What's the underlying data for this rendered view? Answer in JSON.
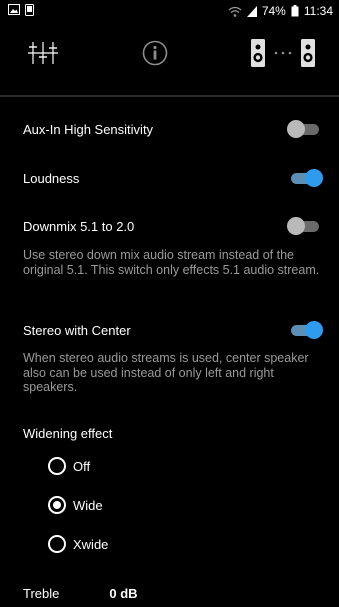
{
  "status_bar": {
    "battery": "74%",
    "time": "11:34",
    "left_icons": [
      "image-notification-icon",
      "phone-notification-icon"
    ],
    "right_icons": [
      "wifi-icon",
      "signal-icon",
      "battery-icon"
    ]
  },
  "top_tabs": [
    {
      "icon": "equalizer-sliders-icon",
      "selected": true
    },
    {
      "icon": "info-icon",
      "selected": false
    },
    {
      "icon": "speakers-icon",
      "selected": false
    }
  ],
  "settings": {
    "aux_in": {
      "label": "Aux-In High Sensitivity",
      "enabled": false
    },
    "loudness": {
      "label": "Loudness",
      "enabled": true
    },
    "downmix": {
      "label": "Downmix 5.1 to 2.0",
      "enabled": false,
      "description": "Use stereo down mix audio stream instead of the original 5.1. This switch only effects 5.1 audio stream."
    },
    "stereo_center": {
      "label": "Stereo with Center",
      "enabled": true,
      "description": "When stereo audio streams is used, center speaker also can be used instead of only left and right speakers."
    }
  },
  "widening": {
    "title": "Widening effect",
    "options": [
      {
        "label": "Off",
        "selected": false
      },
      {
        "label": "Wide",
        "selected": true
      },
      {
        "label": "Xwide",
        "selected": false
      }
    ]
  },
  "treble": {
    "label": "Treble",
    "value": "0 dB"
  },
  "colors": {
    "accent": "#2f9bef",
    "background": "#000000",
    "secondary_text": "#9a9a9a"
  }
}
